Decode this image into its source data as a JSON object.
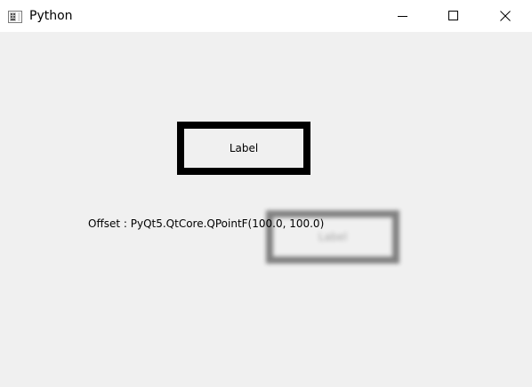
{
  "window": {
    "title": "Python",
    "icon": "python-app-icon",
    "controls": {
      "minimize_icon": "minimize-icon",
      "maximize_icon": "maximize-icon",
      "close_icon": "close-icon"
    }
  },
  "content": {
    "label_text": "Label",
    "shadow_label_text": "Label",
    "offset_prefix": "Offset : ",
    "offset_value": "PyQt5.QtCore.QPointF(100.0, 100.0)"
  },
  "colors": {
    "background": "#f0f0f0",
    "titlebar": "#ffffff",
    "label_border": "#000000",
    "shadow": "#6e6e6e"
  }
}
